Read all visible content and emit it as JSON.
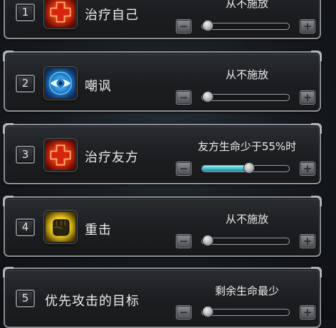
{
  "rows": [
    {
      "index": "1",
      "skill": "治疗自己",
      "icon": "heal-cross-icon",
      "setting": "从不施放",
      "slider_value": 0.0
    },
    {
      "index": "2",
      "skill": "嘲讽",
      "icon": "eye-icon",
      "setting": "从不施放",
      "slider_value": 0.0
    },
    {
      "index": "3",
      "skill": "治疗友方",
      "icon": "heal-cross-icon",
      "setting": "友方生命少于55%时",
      "slider_value": 0.55
    },
    {
      "index": "4",
      "skill": "重击",
      "icon": "fist-icon",
      "setting": "从不施放",
      "slider_value": 0.0
    },
    {
      "index": "5",
      "skill": "优先攻击的目标",
      "icon": "",
      "setting": "剩余生命最少",
      "slider_value": 0.0
    }
  ],
  "colors": {
    "slider_fill": "#3ab3c7",
    "panel_border": "#8d9196",
    "text": "#ececec"
  }
}
